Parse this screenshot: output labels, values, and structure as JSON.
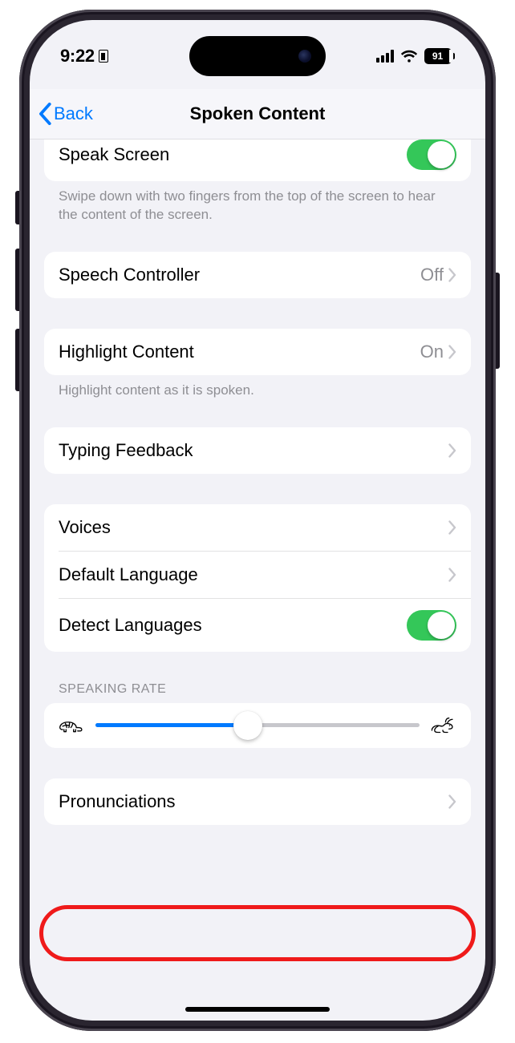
{
  "status": {
    "time": "9:22",
    "battery_pct": "91"
  },
  "nav": {
    "back_label": "Back",
    "title": "Spoken Content"
  },
  "speak_screen": {
    "label": "Speak Screen",
    "footer": "Swipe down with two fingers from the top of the screen to hear the content of the screen."
  },
  "speech_controller": {
    "label": "Speech Controller",
    "value": "Off"
  },
  "highlight_content": {
    "label": "Highlight Content",
    "value": "On",
    "footer": "Highlight content as it is spoken."
  },
  "typing_feedback": {
    "label": "Typing Feedback"
  },
  "voices": {
    "label": "Voices"
  },
  "default_language": {
    "label": "Default Language"
  },
  "detect_languages": {
    "label": "Detect Languages"
  },
  "speaking_rate": {
    "header": "SPEAKING RATE"
  },
  "pronunciations": {
    "label": "Pronunciations"
  }
}
